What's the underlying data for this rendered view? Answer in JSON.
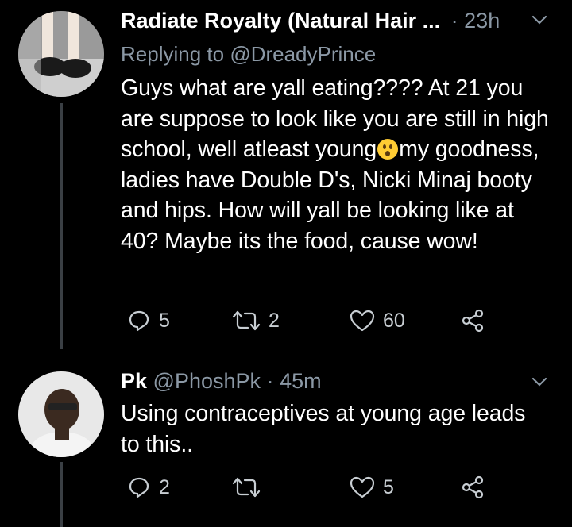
{
  "tweets": [
    {
      "display_name": "Radiate Royalty (Natural Hair ...",
      "separator": "·",
      "time": "23h",
      "replying_prefix": "Replying to",
      "replying_handle": "@DreadyPrince",
      "text_part1": "Guys what are yall eating???? At 21 you are suppose to look like you are still in high school, well atleast young",
      "text_part2": "my goodness, ladies have Double D's, Nicki Minaj booty and hips. How will yall be looking like at 40? Maybe its the food, cause wow!",
      "emoji": "hushed-face-emoji",
      "reply_count": "5",
      "retweet_count": "2",
      "like_count": "60"
    },
    {
      "display_name": "Pk",
      "handle": "@PhoshPk",
      "separator": "·",
      "time": "45m",
      "text": "Using contraceptives at young age leads to this..",
      "reply_count": "2",
      "retweet_count": "",
      "like_count": "5"
    }
  ],
  "colors": {
    "background": "#000000",
    "primary_text": "#ffffff",
    "secondary_text": "#8b98a5",
    "thread_line": "#3a3f44"
  },
  "icons": [
    "chevron-down-icon",
    "reply-icon",
    "retweet-icon",
    "like-icon",
    "share-icon"
  ]
}
